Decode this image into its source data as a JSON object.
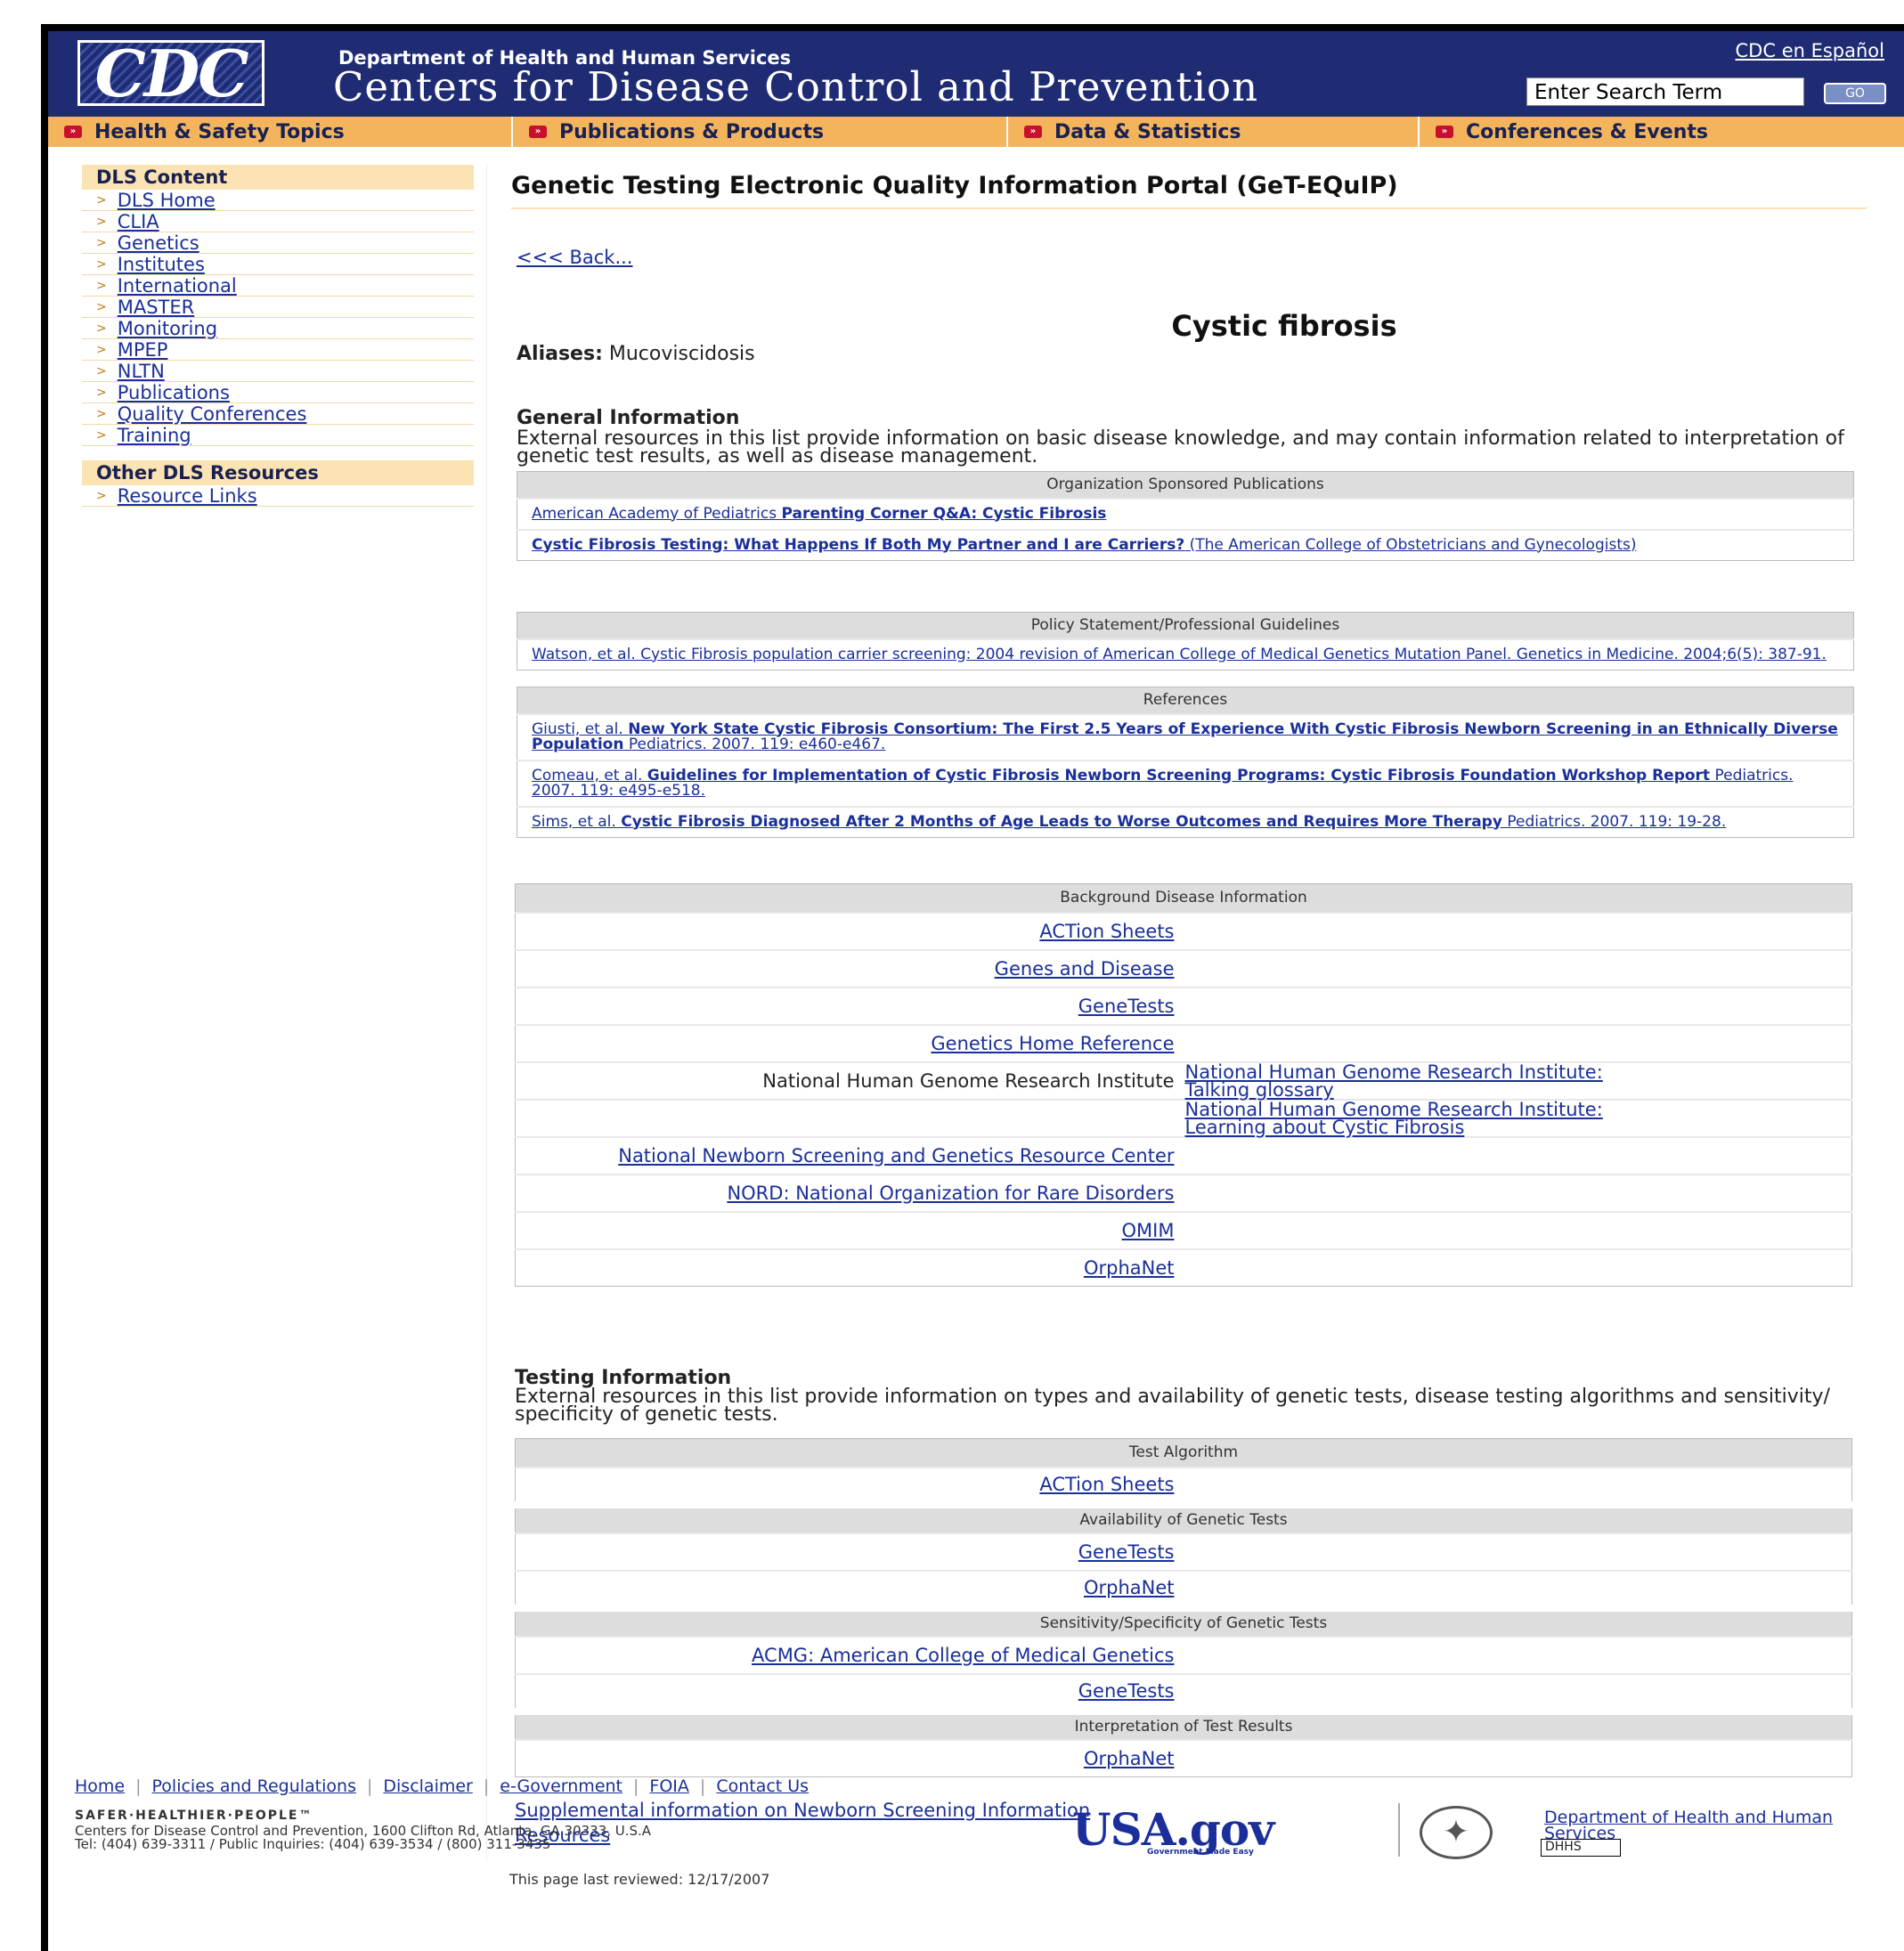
{
  "header": {
    "logo_text": "CDC",
    "department": "Department of Health and Human Services",
    "agency": "Centers for Disease Control and Prevention",
    "spanish_link": "CDC en Español",
    "search_placeholder": "Enter Search Term",
    "go_label": "GO"
  },
  "nav": [
    {
      "label": "Health & Safety Topics"
    },
    {
      "label": "Publications & Products"
    },
    {
      "label": "Data & Statistics"
    },
    {
      "label": "Conferences & Events"
    }
  ],
  "sidebar": {
    "content_title": "DLS Content",
    "content_items": [
      "DLS Home",
      "CLIA",
      "Genetics",
      "Institutes",
      "International",
      "MASTER",
      "Monitoring",
      "MPEP",
      "NLTN",
      "Publications",
      "Quality Conferences",
      "Training"
    ],
    "other_title": "Other DLS Resources",
    "other_items": [
      "Resource Links"
    ]
  },
  "main": {
    "page_title": "Genetic Testing Electronic Quality Information Portal (GeT-EQuIP)",
    "back_link": "<<< Back...",
    "disease_name": "Cystic fibrosis",
    "aliases_label": "Aliases:",
    "aliases_value": "Mucoviscidosis",
    "general": {
      "title": "General Information",
      "description": "External resources in this list provide information on basic disease knowledge, and may contain information related to interpretation of genetic test results, as well as disease management."
    },
    "org_publications": {
      "header": "Organization Sponsored Publications",
      "items": [
        {
          "pre": "American Academy of Pediatrics ",
          "bold": "Parenting Corner Q&A: Cystic Fibrosis",
          "post": ""
        },
        {
          "pre": "",
          "bold": "Cystic Fibrosis Testing: What Happens If Both My Partner and I are Carriers?",
          "post": " (The American College of Obstetricians and Gynecologists)"
        }
      ]
    },
    "policy": {
      "header": "Policy Statement/Professional Guidelines",
      "items": [
        {
          "pre": "Watson, et al. Cystic Fibrosis population carrier screening: 2004 revision of American College of Medical Genetics Mutation Panel. Genetics in Medicine. 2004;6(5): 387-91.",
          "bold": "",
          "post": ""
        }
      ]
    },
    "references": {
      "header": "References",
      "items": [
        {
          "pre": "Giusti, et al. ",
          "bold": "New York State Cystic Fibrosis Consortium: The First 2.5 Years of Experience With Cystic Fibrosis Newborn Screening in an Ethnically Diverse Population",
          "post": " Pediatrics. 2007. 119: e460-e467."
        },
        {
          "pre": "Comeau, et al. ",
          "bold": "Guidelines for Implementation of Cystic Fibrosis Newborn Screening Programs: Cystic Fibrosis Foundation Workshop Report",
          "post": " Pediatrics. 2007. 119: e495-e518."
        },
        {
          "pre": "Sims, et al. ",
          "bold": "Cystic Fibrosis Diagnosed After 2 Months of Age Leads to Worse Outcomes and Requires More Therapy",
          "post": " Pediatrics. 2007. 119: 19-28."
        }
      ]
    },
    "background": {
      "header": "Background Disease Information",
      "rows": [
        {
          "left": "ACTion Sheets",
          "left_is_link": true,
          "right": ""
        },
        {
          "left": "Genes and Disease",
          "left_is_link": true,
          "right": ""
        },
        {
          "left": "GeneTests",
          "left_is_link": true,
          "right": ""
        },
        {
          "left": "Genetics Home Reference",
          "left_is_link": true,
          "right": ""
        },
        {
          "left": "National Human Genome Research Institute",
          "left_is_link": false,
          "right": "National Human Genome Research Institute: Talking glossary"
        },
        {
          "left": "",
          "left_is_link": false,
          "right": "National Human Genome Research Institute: Learning about Cystic Fibrosis"
        },
        {
          "left": "National Newborn Screening and Genetics Resource Center",
          "left_is_link": true,
          "right": ""
        },
        {
          "left": "NORD: National Organization for Rare Disorders",
          "left_is_link": true,
          "right": ""
        },
        {
          "left": "OMIM",
          "left_is_link": true,
          "right": ""
        },
        {
          "left": "OrphaNet",
          "left_is_link": true,
          "right": ""
        }
      ]
    },
    "testing": {
      "title": "Testing Information",
      "description": "External resources in this list provide information on types and availability of genetic tests, disease testing algorithms and sensitivity/ specificity of genetic tests.",
      "groups": [
        {
          "header": "Test Algorithm",
          "links": [
            "ACTion Sheets"
          ]
        },
        {
          "header": "Availability of Genetic Tests",
          "links": [
            "GeneTests",
            "OrphaNet"
          ]
        },
        {
          "header": "Sensitivity/Specificity of Genetic Tests",
          "links": [
            "ACMG: American College of Medical Genetics",
            "GeneTests"
          ]
        },
        {
          "header": "Interpretation of Test Results",
          "links": [
            "OrphaNet"
          ]
        }
      ]
    },
    "supplemental_link": "Supplemental information on Newborn Screening Information Resources",
    "last_reviewed": "This page last reviewed: 12/17/2007"
  },
  "footer": {
    "links": [
      "Home",
      "Policies and Regulations",
      "Disclaimer",
      "e-Government",
      "FOIA",
      "Contact Us"
    ],
    "tagline": "SAFER·HEALTHIER·PEOPLE™",
    "address": "Centers for Disease Control and Prevention, 1600 Clifton Rd, Atlanta, GA 30333, U.S.A",
    "phone": "Tel: (404) 639-3311 / Public Inquiries: (404) 639-3534 / (800) 311-3435",
    "usagov_logo": "USA.gov",
    "usagov_sub": "Government Made Easy",
    "hhs_link": "Department of Health and Human Services",
    "dhhs_box": "DHHS"
  }
}
